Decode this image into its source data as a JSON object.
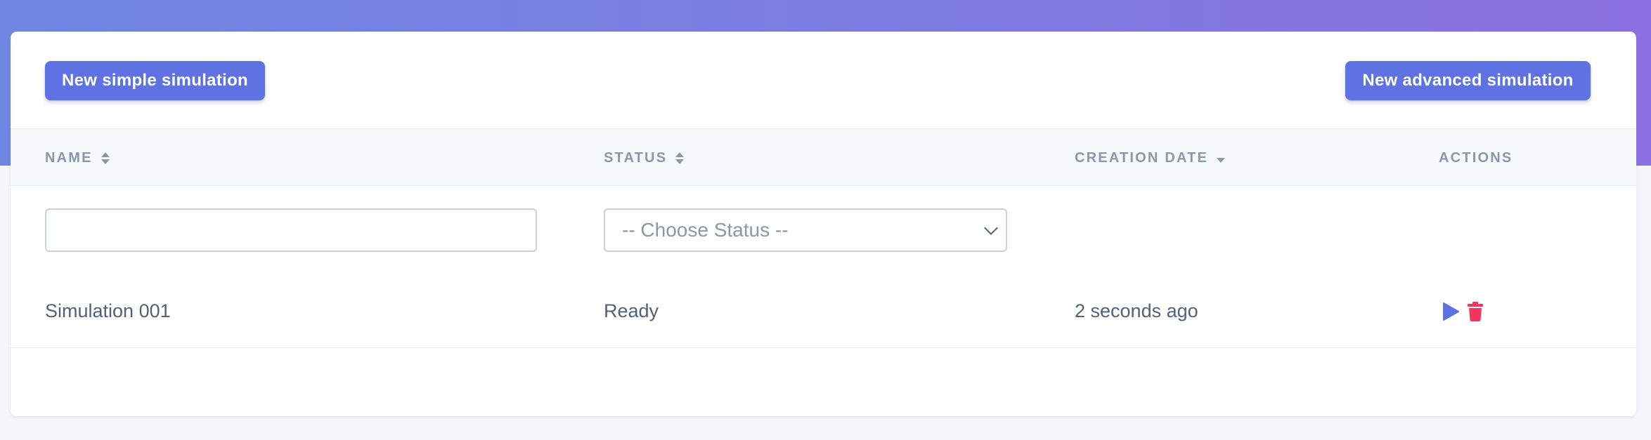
{
  "toolbar": {
    "new_simple_label": "New simple simulation",
    "new_advanced_label": "New advanced simulation"
  },
  "table": {
    "columns": {
      "name": "NAME",
      "status": "STATUS",
      "creation_date": "CREATION DATE",
      "actions": "ACTIONS"
    },
    "filters": {
      "name_value": "",
      "status_selected": "-- Choose Status --"
    },
    "rows": [
      {
        "name": "Simulation 001",
        "status": "Ready",
        "creation_date": "2 seconds ago"
      }
    ]
  },
  "icons": {
    "sort": "sort-icon",
    "sort_desc": "sort-desc-icon",
    "play": "play-icon",
    "delete": "trash-icon"
  },
  "colors": {
    "accent": "#5e72e4",
    "danger": "#f5365c",
    "header_gradient_start": "#6f86e2",
    "header_gradient_end": "#8a70e0"
  }
}
